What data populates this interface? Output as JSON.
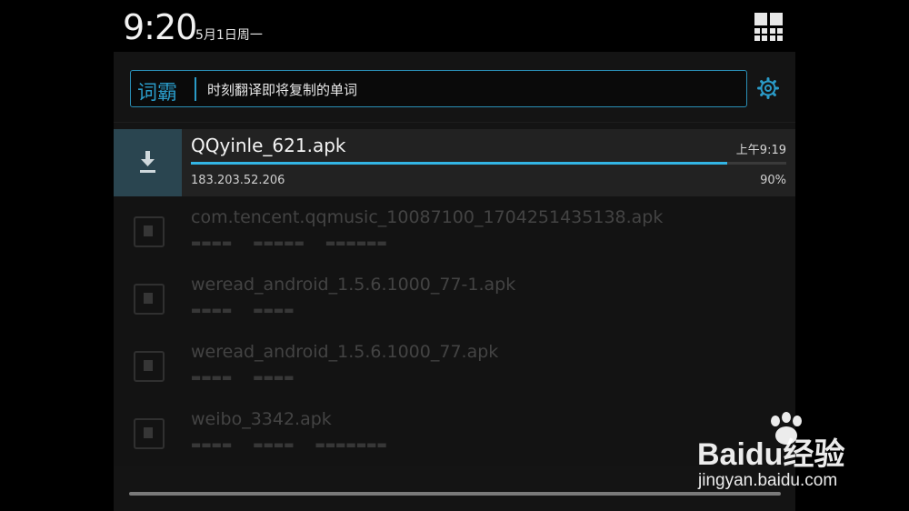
{
  "status_bar": {
    "time": "9:20",
    "date": "5月1日周一"
  },
  "translator": {
    "logo": "词霸",
    "text": "时刻翻译即将复制的单词",
    "icon": "gear-icon"
  },
  "active_download": {
    "file_name": "QQyinle_621.apk",
    "time": "上午9:19",
    "host": "183.203.52.206",
    "progress_text": "90%",
    "progress": 0.9,
    "icon": "download-icon"
  },
  "completed_downloads": [
    {
      "file_name": "com.tencent.qqmusic_10087100_1704251435138.apk"
    },
    {
      "file_name": "weread_android_1.5.6.1000_77-1.apk"
    },
    {
      "file_name": "weread_android_1.5.6.1000_77.apk"
    },
    {
      "file_name": "weibo_3342.apk"
    }
  ],
  "watermark": {
    "logo": "Baidu经验",
    "url": "jingyan.baidu.com"
  },
  "colors": {
    "accent": "#33b5e5",
    "panel_bg": "#141414"
  }
}
